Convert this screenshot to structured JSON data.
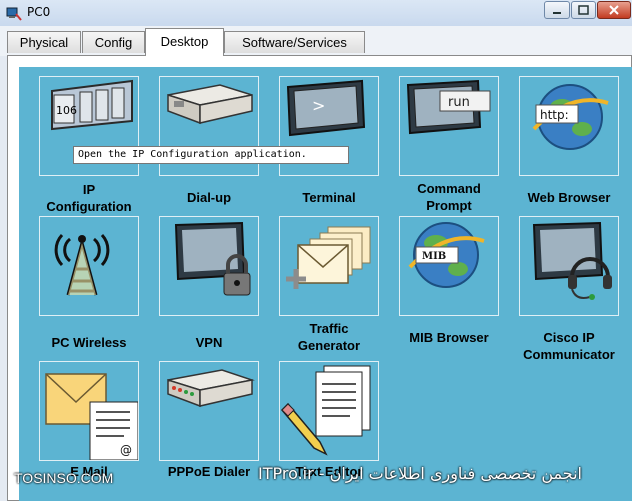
{
  "window": {
    "title": "PC0"
  },
  "tabs": [
    {
      "label": "Physical"
    },
    {
      "label": "Config"
    },
    {
      "label": "Desktop"
    },
    {
      "label": "Software/Services"
    }
  ],
  "active_tab": "Desktop",
  "tooltip": "Open the IP Configuration application.",
  "apps": [
    {
      "label": "IP\nConfiguration",
      "icon": "ip-configuration-icon",
      "icon_text": "106"
    },
    {
      "label": "Dial-up",
      "icon": "modem-icon"
    },
    {
      "label": "Terminal",
      "icon": "terminal-icon",
      "icon_text": ">"
    },
    {
      "label": "Command\nPrompt",
      "icon": "command-prompt-icon",
      "icon_text": "run"
    },
    {
      "label": "Web Browser",
      "icon": "globe-icon",
      "icon_text": "http:"
    },
    {
      "label": "PC Wireless",
      "icon": "wireless-tower-icon"
    },
    {
      "label": "VPN",
      "icon": "monitor-lock-icon"
    },
    {
      "label": "Traffic\nGenerator",
      "icon": "envelopes-icon"
    },
    {
      "label": "MIB Browser",
      "icon": "mib-globe-icon",
      "icon_text": "MIB"
    },
    {
      "label": "Cisco IP\nCommunicator",
      "icon": "monitor-headset-icon"
    },
    {
      "label": "E Mail",
      "icon": "envelope-letter-icon",
      "icon_text": "@"
    },
    {
      "label": "PPPoE Dialer",
      "icon": "pppoe-modem-icon"
    },
    {
      "label": "Text Editor",
      "icon": "pencil-document-icon"
    }
  ],
  "watermark": {
    "left": "TOSINSO.COM",
    "right": "انجمن تخصصی فناوری اطلاعات ایران - ITPro.ir"
  },
  "colors": {
    "desktop_bg": "#5cb4d2",
    "tile_border": "#dfeff5"
  }
}
